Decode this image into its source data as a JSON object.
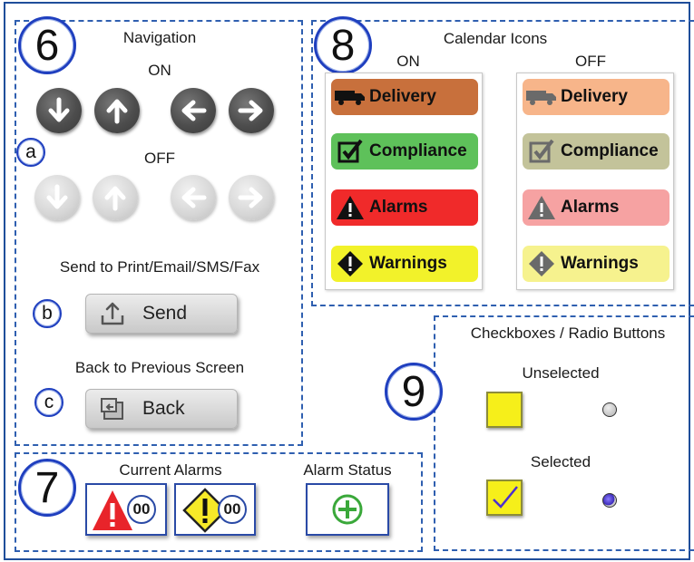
{
  "sections": {
    "s6": {
      "number": "6",
      "title": "Navigation",
      "on_label": "ON",
      "off_label": "OFF"
    },
    "s7": {
      "number": "7",
      "current_alarms": "Current Alarms",
      "alarm_status": "Alarm Status",
      "alarm_count": "00",
      "warning_count": "00"
    },
    "s8": {
      "number": "8",
      "title": "Calendar Icons",
      "on_label": "ON",
      "off_label": "OFF"
    },
    "s9": {
      "number": "9",
      "title": "Checkboxes / Radio Buttons",
      "unselected": "Unselected",
      "selected": "Selected"
    }
  },
  "sub": {
    "a": "a",
    "b": "b",
    "c": "c"
  },
  "send": {
    "caption": "Send to Print/Email/SMS/Fax",
    "label": "Send"
  },
  "back": {
    "caption": "Back to Previous Screen",
    "label": "Back"
  },
  "calendar": {
    "on": [
      {
        "label": "Delivery",
        "icon": "truck-icon",
        "color": "#c8703c"
      },
      {
        "label": "Compliance",
        "icon": "checkbox-icon",
        "color": "#5ec15a"
      },
      {
        "label": "Alarms",
        "icon": "warning-triangle-icon",
        "color": "#f02a2a"
      },
      {
        "label": "Warnings",
        "icon": "warning-diamond-icon",
        "color": "#f2f22a"
      }
    ],
    "off": [
      {
        "label": "Delivery",
        "icon": "truck-icon",
        "color": "#f7b58a"
      },
      {
        "label": "Compliance",
        "icon": "checkbox-icon",
        "color": "#c3c39a"
      },
      {
        "label": "Alarms",
        "icon": "warning-triangle-icon",
        "color": "#f6a2a2"
      },
      {
        "label": "Warnings",
        "icon": "warning-diamond-icon",
        "color": "#f6f28e"
      }
    ]
  },
  "colors": {
    "accent_blue": "#1f3fbf",
    "checkbox_yellow": "#f6ef1a"
  }
}
